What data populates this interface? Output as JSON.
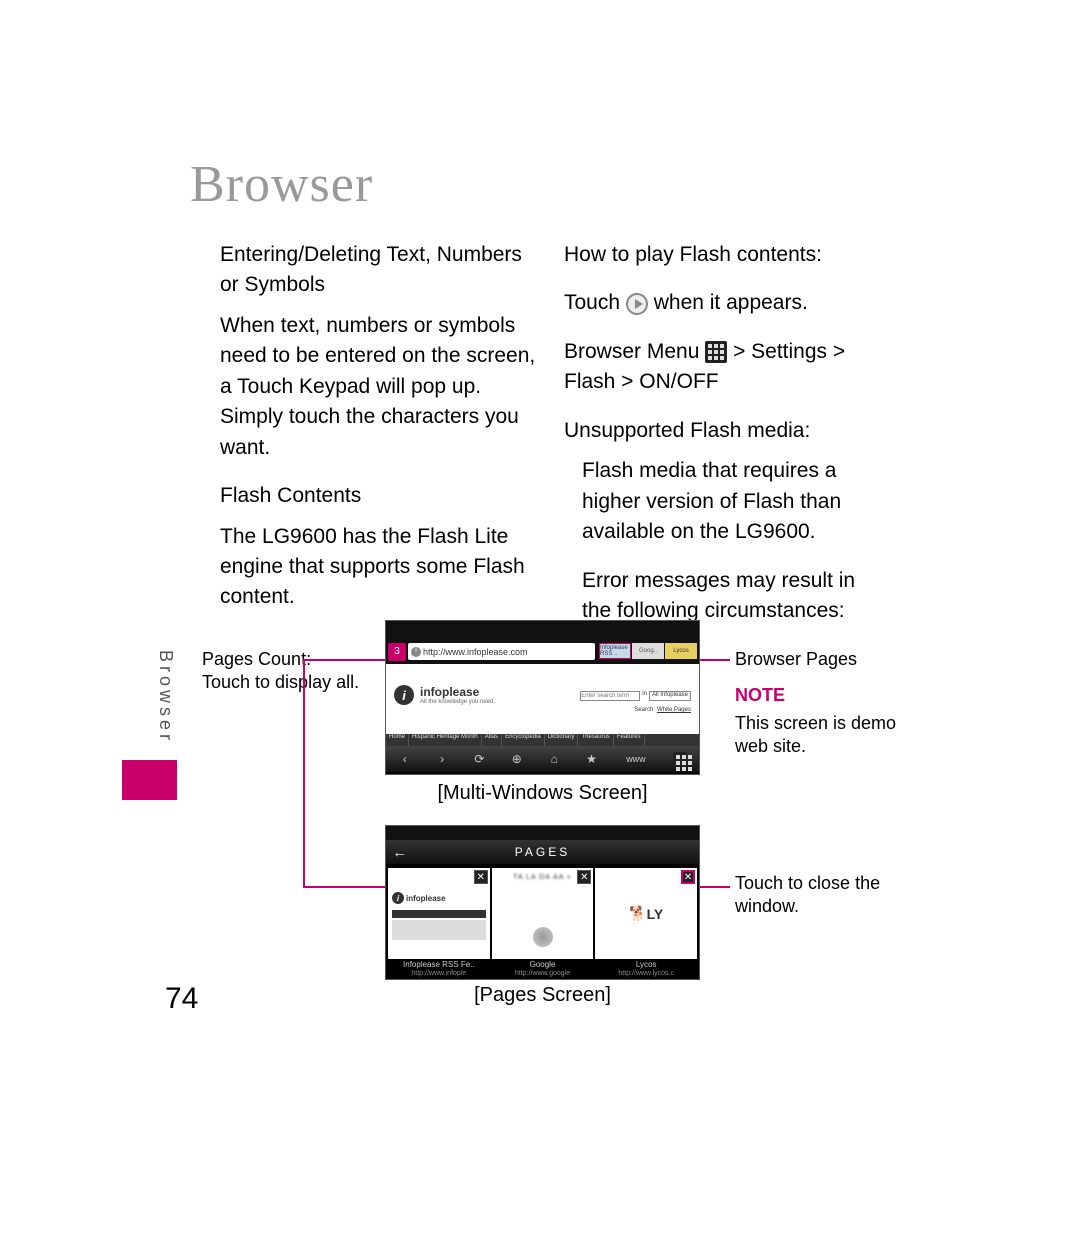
{
  "chapter_title": "Browser",
  "side_tab": "Browser",
  "page_number": "74",
  "left_col": {
    "h1": "Entering/Deleting Text, Numbers or Symbols",
    "p1": "When text, numbers or symbols need to be entered on the screen, a Touch Keypad will pop up. Simply touch the characters you want.",
    "h2": "Flash Contents",
    "p2": "The LG9600 has the Flash Lite engine that supports some Flash content."
  },
  "right_col": {
    "l1": "How to play Flash contents:",
    "l2a": "Touch ",
    "l2b": " when it appears.",
    "l3a": "Browser Menu ",
    "l3b": " > Settings > Flash > ON/OFF",
    "h3": "Unsupported Flash media:",
    "p3": "Flash media that requires a higher version of Flash than available on the LG9600.",
    "p4": "Error messages may result in the following circumstances:"
  },
  "labels": {
    "pages_count": "Pages Count:",
    "touch_display": "Touch to display all.",
    "browser_pages": "Browser Pages",
    "note": "NOTE",
    "note_text": "This screen is demo web site.",
    "close_window": "Touch to close the window."
  },
  "captions": {
    "multi": "[Multi-Windows Screen]",
    "pages": "[Pages Screen]"
  },
  "shot1": {
    "pages_badge": "3",
    "url": "http://www.infoplease.com",
    "tab1": "Infoplease RSS ..",
    "tab2": "Goog..",
    "tab3": "Lycos",
    "logo": "infoplease",
    "logo_sub": "All the knowledge you need.",
    "search_ph": "Enter search term",
    "search_in": "in",
    "search_scope": "All Infoplease",
    "search_sub": "Search:",
    "search_wp": "White Pages",
    "nav": [
      "Home",
      "Hispanic Heritage Month",
      "Atlas",
      "Encyclopedia",
      "Dictionary",
      "Thesaurus",
      "Features"
    ],
    "toolbar_www": "www"
  },
  "shot2": {
    "title": "PAGES",
    "cards": [
      {
        "name": "Infoplease RSS Fe..",
        "url": "http://www.infople",
        "logo": "infoplease"
      },
      {
        "name": "Google",
        "url": "http://www.google",
        "top": "TA  LA  DA  AA  »"
      },
      {
        "name": "Lycos",
        "url": "http://www.lycos.c",
        "ly": "LY"
      }
    ]
  }
}
